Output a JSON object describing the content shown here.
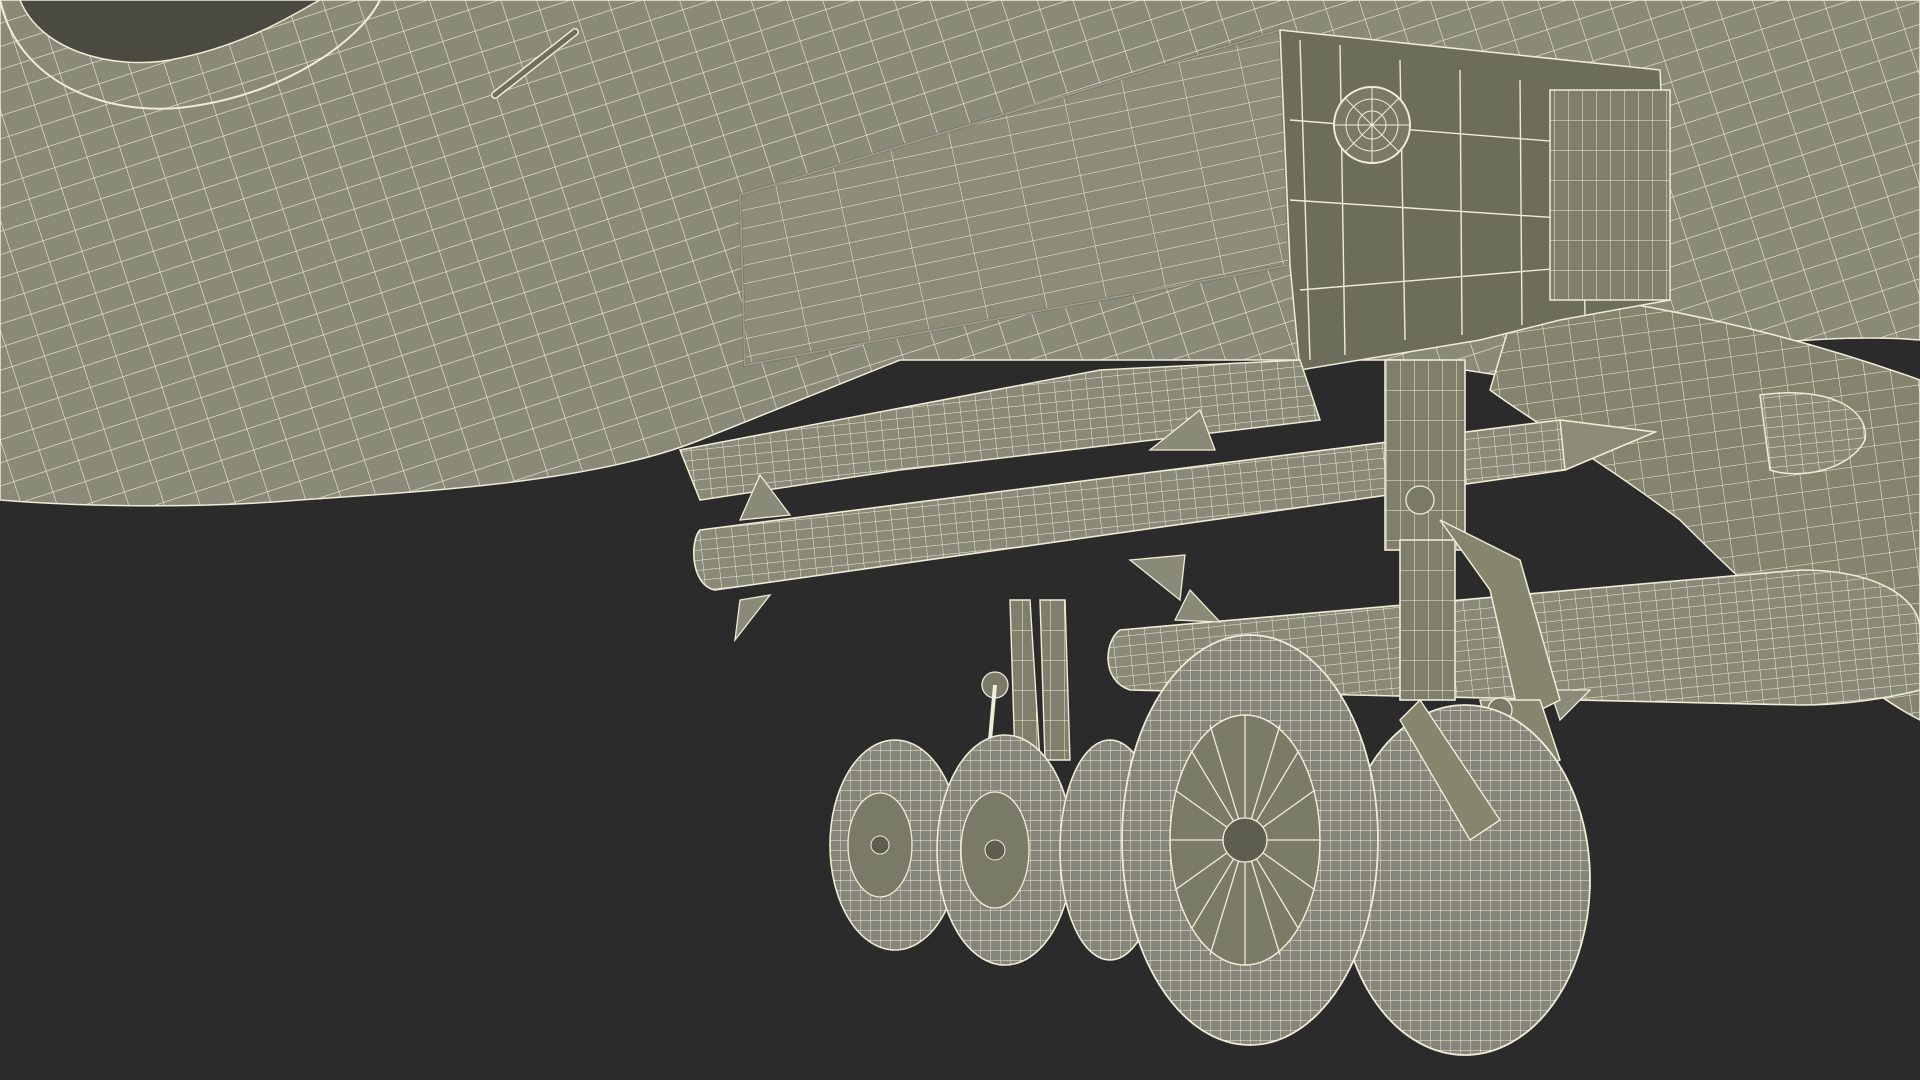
{
  "scene": {
    "subject": "",
    "background_color": "#2b2b2b",
    "surface_color": "#8a8a78",
    "surface_shade_color": "#75755f",
    "wire_color": "#efecd7",
    "dark_gap_color": "#4a4a40"
  }
}
